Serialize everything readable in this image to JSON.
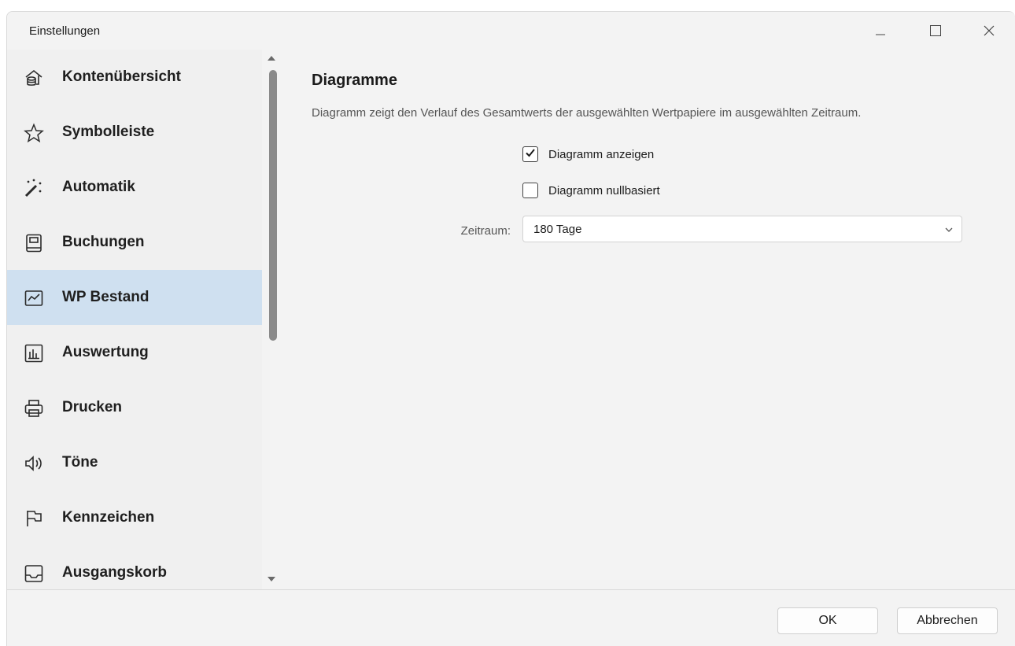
{
  "window": {
    "title": "Einstellungen",
    "controls": [
      "minimize-icon",
      "maximize-icon",
      "close-icon"
    ]
  },
  "sidebar": {
    "items": [
      {
        "label": "Kontenübersicht",
        "icon": "account-overview-icon",
        "selected": false
      },
      {
        "label": "Symbolleiste",
        "icon": "star-icon",
        "selected": false
      },
      {
        "label": "Automatik",
        "icon": "magic-wand-icon",
        "selected": false
      },
      {
        "label": "Buchungen",
        "icon": "book-icon",
        "selected": false
      },
      {
        "label": "WP Bestand",
        "icon": "line-chart-icon",
        "selected": true
      },
      {
        "label": "Auswertung",
        "icon": "bar-chart-icon",
        "selected": false
      },
      {
        "label": "Drucken",
        "icon": "printer-icon",
        "selected": false
      },
      {
        "label": "Töne",
        "icon": "speaker-icon",
        "selected": false
      },
      {
        "label": "Kennzeichen",
        "icon": "flag-icon",
        "selected": false
      },
      {
        "label": "Ausgangskorb",
        "icon": "outbox-icon",
        "selected": false
      }
    ],
    "selected_color": "#cfe0f0"
  },
  "content": {
    "title": "Diagramme",
    "description": "Diagramm zeigt den Verlauf des Gesamtwerts der ausgewählten Wertpapiere im ausgewählten Zeitraum.",
    "show_chart": {
      "label": "Diagramm anzeigen",
      "checked": true
    },
    "zero_based": {
      "label": "Diagramm nullbasiert",
      "checked": false
    },
    "period": {
      "label": "Zeitraum:",
      "value": "180 Tage"
    }
  },
  "footer": {
    "ok_label": "OK",
    "cancel_label": "Abbrechen"
  }
}
